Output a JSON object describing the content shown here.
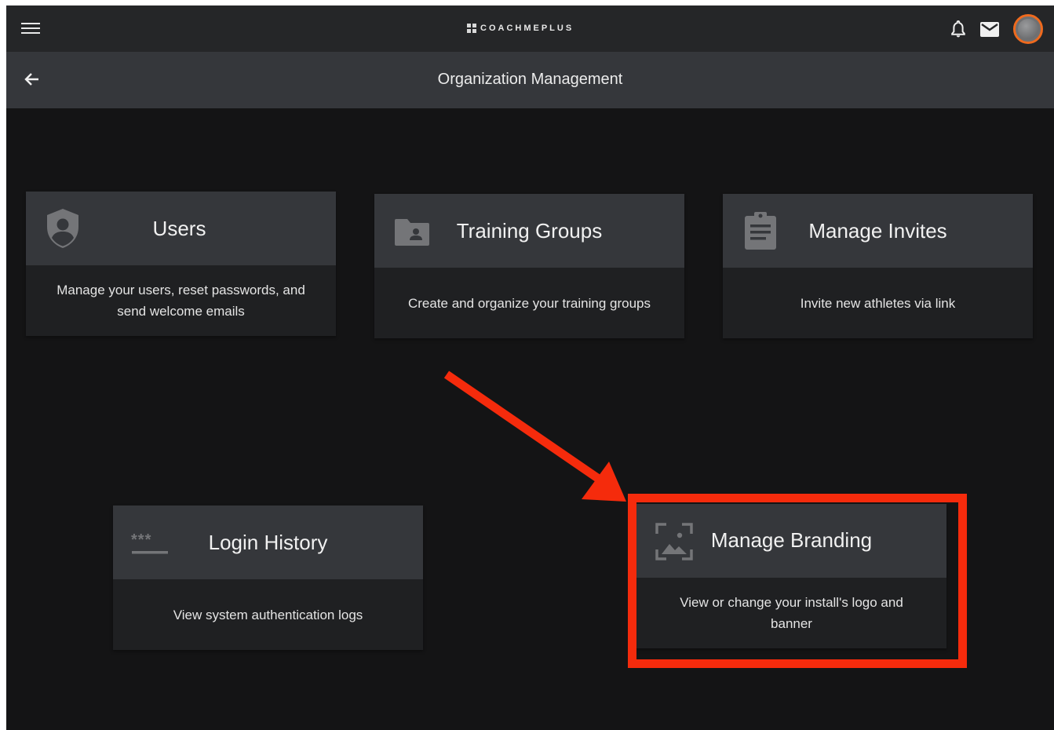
{
  "app": {
    "brand": "COACHMEPLUS",
    "page_title": "Organization Management"
  },
  "cards": [
    {
      "title": "Users",
      "description": "Manage your users, reset passwords, and send welcome emails",
      "icon": "shield-user-icon"
    },
    {
      "title": "Training Groups",
      "description": "Create and organize your training groups",
      "icon": "folder-user-icon"
    },
    {
      "title": "Manage Invites",
      "description": "Invite new athletes via link",
      "icon": "clipboard-icon"
    },
    {
      "title": "Login History",
      "description": "View system authentication logs",
      "icon": "password-icon"
    },
    {
      "title": "Manage Branding",
      "description": "View or change your install's logo and banner",
      "icon": "image-frame-icon"
    }
  ],
  "annotation": {
    "highlight_color": "#f52b0c",
    "target": "Manage Branding"
  }
}
